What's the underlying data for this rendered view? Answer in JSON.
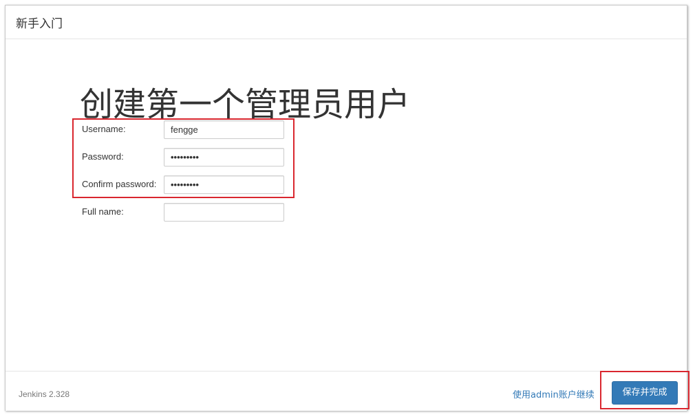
{
  "header": {
    "title": "新手入门"
  },
  "main": {
    "page_title": "创建第一个管理员用户",
    "fields": {
      "username": {
        "label": "Username:",
        "value": "fengge"
      },
      "password": {
        "label": "Password:",
        "value": "•••••••••"
      },
      "confirm_password": {
        "label": "Confirm password:",
        "value": "•••••••••"
      },
      "full_name": {
        "label": "Full name:",
        "value": ""
      }
    }
  },
  "footer": {
    "version": "Jenkins 2.328",
    "continue_link": "使用admin账户继续",
    "save_button": "保存并完成"
  },
  "colors": {
    "primary_button": "#337ab7",
    "highlight": "#d9262e",
    "link": "#337ab7"
  }
}
